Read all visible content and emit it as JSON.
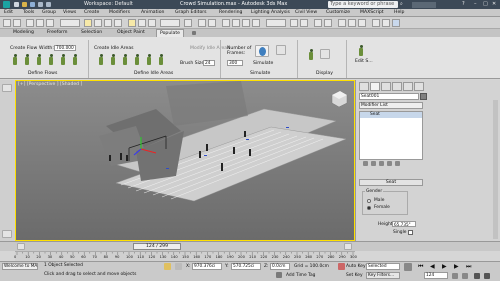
{
  "titlebar": {
    "workspace": "Workspace: Default",
    "title": "Crowd Simulation.max - Autodesk 3ds Max",
    "search_placeholder": "Type a keyword or phrase"
  },
  "menus": [
    "Edit",
    "Tools",
    "Group",
    "Views",
    "Create",
    "Modifiers",
    "Animation",
    "Graph Editors",
    "Rendering",
    "Lighting Analysis",
    "Civil View",
    "Customize",
    "MAXScript",
    "Help"
  ],
  "ribbon_tabs": [
    "Modeling",
    "Freeform",
    "Selection",
    "Object Paint",
    "Populate"
  ],
  "active_tab": "Populate",
  "ribbon": {
    "create_flows_label": "Create Flow",
    "width_label": "Width:",
    "width_value": "700.000",
    "create_idle_areas_label": "Create Idle Areas",
    "modify_idle_areas": "Modify Idle Areas",
    "brush_size_label": "Brush Size:",
    "brush_size_value": "24",
    "frames_label": "Number of Frames:",
    "frames_value": "300",
    "simulate_label": "Simulate",
    "edit_label": "Edit S...",
    "groups": [
      "Define Flows",
      "Define Idle Areas",
      "Simulate",
      "Display"
    ]
  },
  "viewport": {
    "label": "[+] [Perspective ] [Shaded ]"
  },
  "command_panel": {
    "object_name": "Seat001",
    "modifier_list": "Modifier List",
    "stack_item": "Seat",
    "rollout_title": "Seat",
    "gender_label": "Gender",
    "male_label": "Male",
    "female_label": "Female",
    "height_label": "Height:",
    "height_value": "65.735\"",
    "single_label": "Single",
    "gender_selected": "Female"
  },
  "timeline": {
    "frame_label": "124 / 299",
    "ticks": [
      "0",
      "10",
      "20",
      "30",
      "40",
      "50",
      "60",
      "70",
      "80",
      "90",
      "100",
      "110",
      "120",
      "130",
      "140",
      "150",
      "160",
      "170",
      "180",
      "190",
      "200",
      "210",
      "220",
      "230",
      "240",
      "250",
      "260",
      "270",
      "280",
      "290",
      "300"
    ]
  },
  "status": {
    "welcome": "Welcome to MA",
    "selection": "1 Object Selected",
    "prompt": "Click and drag to select and move objects",
    "x_label": "X:",
    "x_value": "970.376ci",
    "y_label": "Y:",
    "y_value": "570.725ci",
    "z_label": "Z:",
    "z_value": "0.0cm",
    "grid": "Grid = 100.0cm",
    "add_time_tag": "Add Time Tag",
    "auto_key": "Auto Key",
    "set_key": "Set Key",
    "selected": "Selected",
    "key_filters": "Key Filters...",
    "frame": "124"
  }
}
